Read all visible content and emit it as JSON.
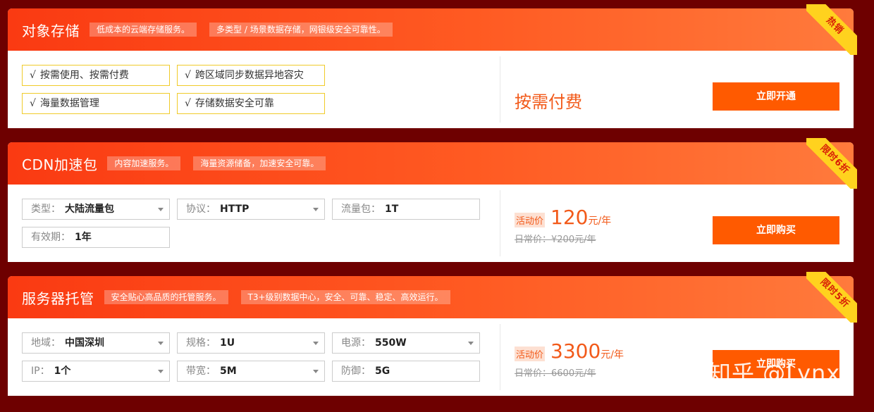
{
  "cards": [
    {
      "title": "对象存储",
      "tags": [
        "低成本的云端存储服务。",
        "多类型 / 场景数据存储，网银级安全可靠性。"
      ],
      "ribbon": "热销",
      "features": [
        "√",
        "按需使用、按需付费",
        "跨区域同步数据异地容灾",
        "海量数据管理",
        "存储数据安全可靠"
      ],
      "price_text": "按需付费",
      "button": "立即开通"
    },
    {
      "title": "CDN加速包",
      "tags": [
        "内容加速服务。",
        "海量资源储备，加速安全可靠。"
      ],
      "ribbon": "限时6折",
      "fields": [
        {
          "label": "类型：",
          "value": "大陆流量包"
        },
        {
          "label": "协议：",
          "value": "HTTP"
        },
        {
          "label": "流量包：",
          "value": "1T"
        },
        {
          "label": "有效期：",
          "value": "1年"
        }
      ],
      "act_label": "活动价",
      "price": "120",
      "unit": "元/年",
      "orig": "日常价：¥200元/年",
      "button": "立即购买"
    },
    {
      "title": "服务器托管",
      "tags": [
        "安全贴心高品质的托管服务。",
        "T3+级别数据中心，安全、可靠、稳定、高效运行。"
      ],
      "ribbon": "限时5折",
      "fields": [
        {
          "label": "地域：",
          "value": "中国深圳"
        },
        {
          "label": "规格：",
          "value": "1U"
        },
        {
          "label": "电源：",
          "value": "550W"
        },
        {
          "label": "IP：",
          "value": "1个"
        },
        {
          "label": "带宽：",
          "value": "5M"
        },
        {
          "label": "防御：",
          "value": "5G"
        }
      ],
      "act_label": "活动价",
      "price": "3300",
      "unit": "元/年",
      "orig": "日常价：6600元/年",
      "button": "立即购买"
    }
  ],
  "watermark": "知乎 @Lynx",
  "colors": {
    "background": "#6e0000",
    "header_start": "#fa3a12",
    "header_end": "#ff7a3c",
    "accent": "#f25a1a",
    "button": "#ff5a00",
    "ribbon": "#ffd21e",
    "feature_border": "#f0cb2a"
  },
  "icons": {
    "dropdown": "caret-down-icon"
  }
}
